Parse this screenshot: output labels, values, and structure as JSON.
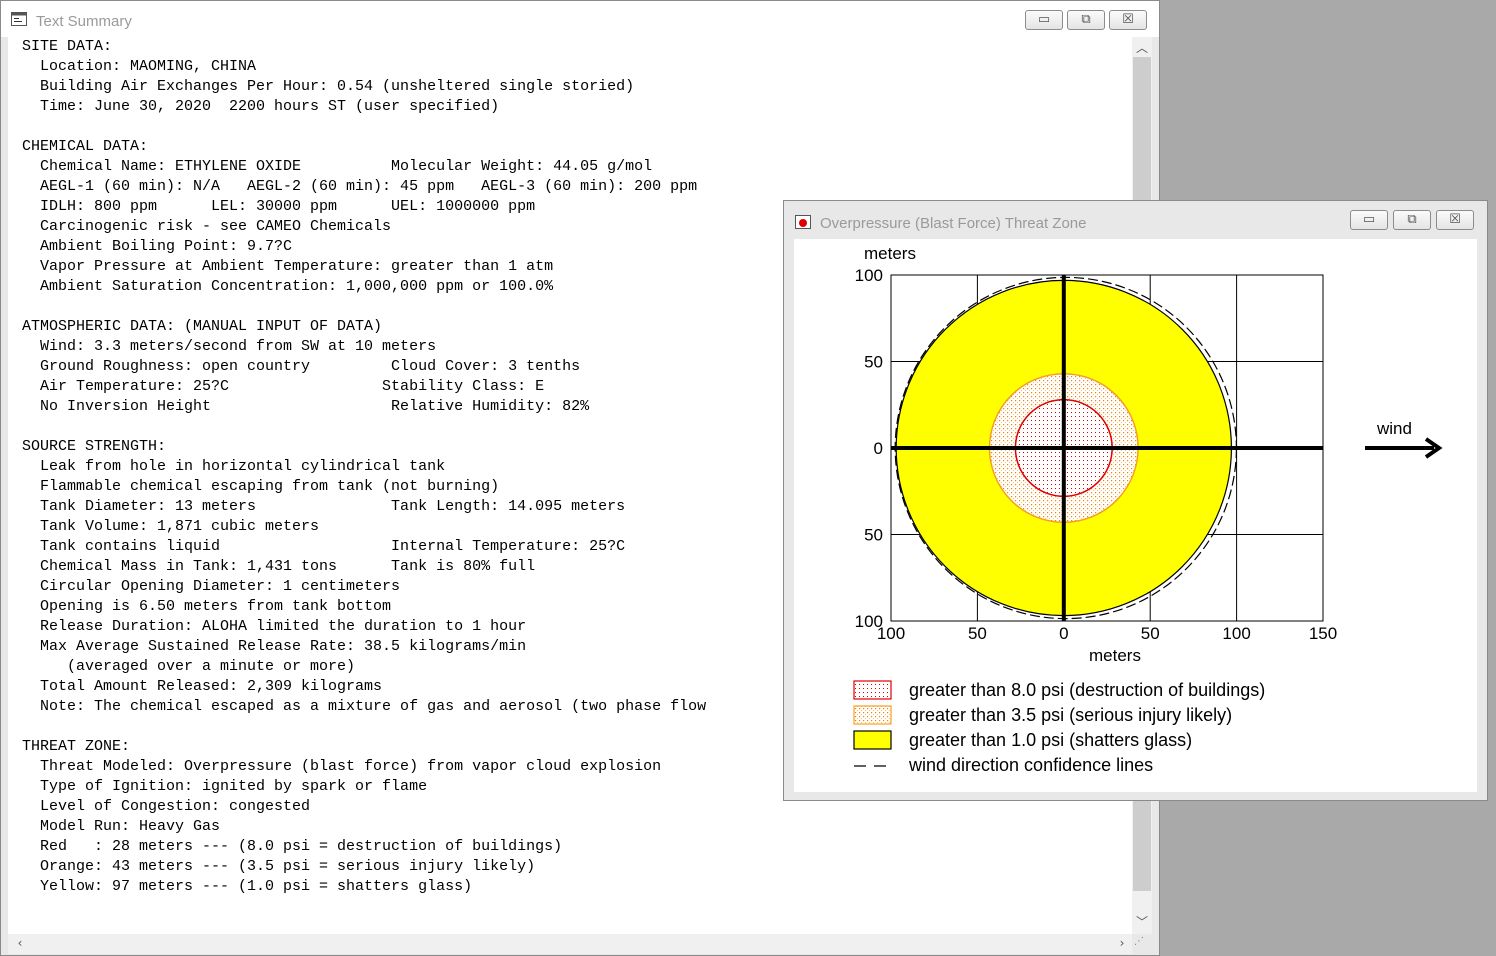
{
  "text_window": {
    "title": "Text Summary",
    "controls": {
      "minimize": "▭",
      "maximize": "⧉",
      "close": "☒"
    },
    "lines": [
      "SITE DATA:",
      "  Location: MAOMING, CHINA",
      "  Building Air Exchanges Per Hour: 0.54 (unsheltered single storied)",
      "  Time: June 30, 2020  2200 hours ST (user specified)",
      "",
      "CHEMICAL DATA:",
      "  Chemical Name: ETHYLENE OXIDE          Molecular Weight: 44.05 g/mol",
      "  AEGL-1 (60 min): N/A   AEGL-2 (60 min): 45 ppm   AEGL-3 (60 min): 200 ppm",
      "  IDLH: 800 ppm      LEL: 30000 ppm      UEL: 1000000 ppm",
      "  Carcinogenic risk - see CAMEO Chemicals",
      "  Ambient Boiling Point: 9.7?C",
      "  Vapor Pressure at Ambient Temperature: greater than 1 atm",
      "  Ambient Saturation Concentration: 1,000,000 ppm or 100.0%",
      "",
      "ATMOSPHERIC DATA: (MANUAL INPUT OF DATA)",
      "  Wind: 3.3 meters/second from SW at 10 meters",
      "  Ground Roughness: open country         Cloud Cover: 3 tenths",
      "  Air Temperature: 25?C                 Stability Class: E",
      "  No Inversion Height                    Relative Humidity: 82%",
      "",
      "SOURCE STRENGTH:",
      "  Leak from hole in horizontal cylindrical tank",
      "  Flammable chemical escaping from tank (not burning)",
      "  Tank Diameter: 13 meters               Tank Length: 14.095 meters",
      "  Tank Volume: 1,871 cubic meters",
      "  Tank contains liquid                   Internal Temperature: 25?C",
      "  Chemical Mass in Tank: 1,431 tons      Tank is 80% full",
      "  Circular Opening Diameter: 1 centimeters",
      "  Opening is 6.50 meters from tank bottom",
      "  Release Duration: ALOHA limited the duration to 1 hour",
      "  Max Average Sustained Release Rate: 38.5 kilograms/min",
      "     (averaged over a minute or more)",
      "  Total Amount Released: 2,309 kilograms",
      "  Note: The chemical escaped as a mixture of gas and aerosol (two phase flow",
      "",
      "THREAT ZONE:",
      "  Threat Modeled: Overpressure (blast force) from vapor cloud explosion",
      "  Type of Ignition: ignited by spark or flame",
      "  Level of Congestion: congested",
      "  Model Run: Heavy Gas",
      "  Red   : 28 meters --- (8.0 psi = destruction of buildings)",
      "  Orange: 43 meters --- (3.5 psi = serious injury likely)",
      "  Yellow: 97 meters --- (1.0 psi = shatters glass)"
    ]
  },
  "plot_window": {
    "title": "Overpressure (Blast Force) Threat Zone",
    "controls": {
      "minimize": "▭",
      "maximize": "⧉",
      "close": "☒"
    },
    "wind_label": "wind"
  },
  "chart_data": {
    "type": "area",
    "xlabel": "meters",
    "ylabel": "meters",
    "xlim": [
      -100,
      150
    ],
    "ylim": [
      -100,
      100
    ],
    "x_ticks": [
      -100,
      -50,
      0,
      50,
      100,
      150
    ],
    "y_ticks": [
      100,
      50,
      0,
      -50,
      -100
    ],
    "x_tick_labels": [
      "100",
      "50",
      "0",
      "50",
      "100",
      "150"
    ],
    "y_tick_labels": [
      "100",
      "50",
      "0",
      "50",
      "100"
    ],
    "grid": true,
    "zones": [
      {
        "name": "greater than 8.0 psi (destruction of buildings)",
        "radius_m": 28,
        "color": "#ff0000",
        "fill": "dotted-red"
      },
      {
        "name": "greater than 3.5 psi (serious injury likely)",
        "radius_m": 43,
        "color": "#ff8c00",
        "fill": "dotted-orange"
      },
      {
        "name": "greater than 1.0 psi (shatters glass)",
        "radius_m": 97,
        "color": "#ffff00",
        "fill": "solid-yellow"
      }
    ],
    "confidence_line_label": "wind direction confidence lines",
    "legend_position": "bottom"
  }
}
